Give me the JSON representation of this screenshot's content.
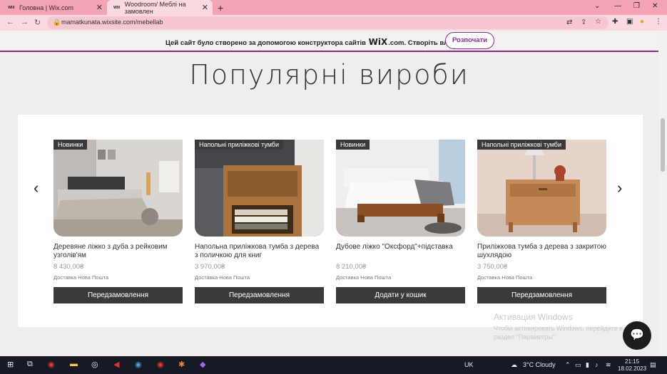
{
  "browser": {
    "tabs": [
      {
        "title": "Головна | Wix.com",
        "favicon": "WIX"
      },
      {
        "title": "Woodroom/ Меблі на замовлен",
        "favicon": "WIX"
      }
    ],
    "url": "mamatkunata.wixsite.com/mebellab"
  },
  "wix_banner": {
    "text_before": "Цей сайт було створено за допомогою конструктора сайтів",
    "logo": "WiX",
    "text_after": ".com. Створіть власний сайт.",
    "button": "Розпочати"
  },
  "section": {
    "title": "Популярні вироби"
  },
  "products": [
    {
      "ribbon": "Новинки",
      "name": "Деревяне ліжко з дуба з рейковим узголів'ям",
      "price": "8 430,00₴",
      "shipping": "Доставка Нова Пошта",
      "button": "Передзамовлення"
    },
    {
      "ribbon": "Напольні приліжкові тумби",
      "name": "Напольна приліжкова тумба з дерева з поличкою для книг",
      "price": "3 970,00₴",
      "shipping": "Доставка Нова Пошта",
      "button": "Передзамовлення"
    },
    {
      "ribbon": "Новинки",
      "name": "Дубове ліжко \"Оксфорд\"+підставка",
      "price": "8 210,00₴",
      "shipping": "Доставка Нова Пошта",
      "button": "Додати у кошик"
    },
    {
      "ribbon": "Напольні приліжкові тумби",
      "name": "Приліжкова тумба з дерева з закритою шухлядою",
      "price": "3 750,00₴",
      "shipping": "Доставка Нова Пошта",
      "button": "Передзамовлення"
    }
  ],
  "windows_activation": {
    "title": "Активация Windows",
    "subtitle": "Чтобы активировать Windows, перейдите в раздел \"Параметры\"."
  },
  "taskbar": {
    "lang": "UK",
    "weather": "3°C  Cloudy",
    "time": "21:15",
    "date": "18.02.2023"
  }
}
